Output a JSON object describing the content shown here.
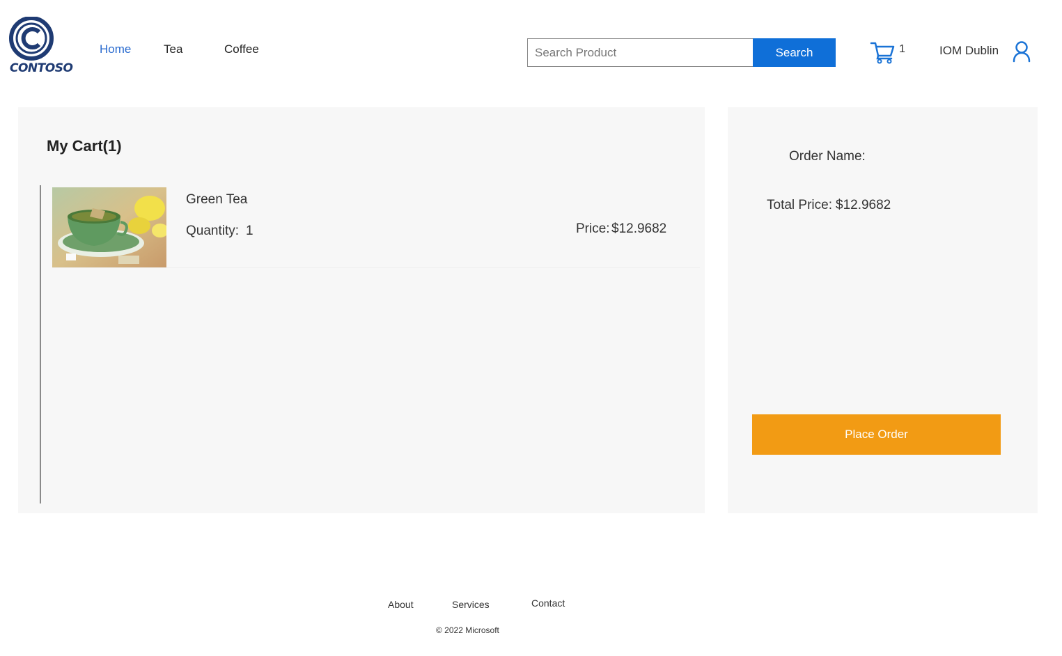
{
  "header": {
    "logo_text": "CONTOSO",
    "nav": {
      "home": "Home",
      "tea": "Tea",
      "coffee": "Coffee"
    },
    "search": {
      "placeholder": "Search Product",
      "value": "",
      "button_label": "Search"
    },
    "cart_count": "1",
    "user_name": "IOM Dublin",
    "icons": {
      "cart": "cart-icon",
      "user": "user-icon"
    }
  },
  "cart": {
    "title": "My Cart(1)",
    "items": [
      {
        "name": "Green Tea",
        "quantity_label": "Quantity:",
        "quantity": "1",
        "price_label": "Price:",
        "price": "$12.9682",
        "image": "green-tea-cup-photo"
      }
    ]
  },
  "order": {
    "name_label": "Order Name:",
    "total_label": "Total Price:",
    "total_value": "$12.9682",
    "place_order_label": "Place Order"
  },
  "footer": {
    "about": "About",
    "services": "Services",
    "contact": "Contact",
    "copyright": "© 2022 Microsoft"
  },
  "colors": {
    "accent_blue": "#0f6fd8",
    "nav_active": "#2a6bcf",
    "place_order": "#f29b14",
    "panel_bg": "#f7f7f7",
    "logo_blue": "#1f3b73"
  }
}
